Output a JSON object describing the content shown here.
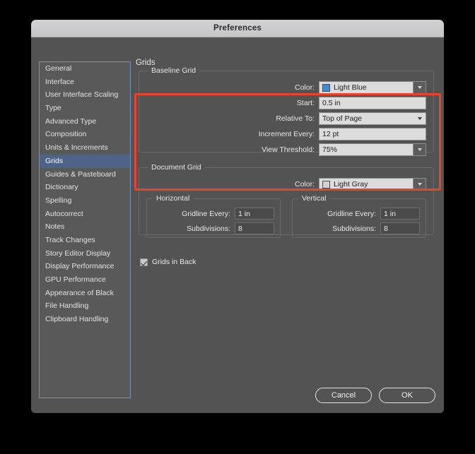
{
  "window": {
    "title": "Preferences"
  },
  "sidebar": {
    "items": [
      {
        "label": "General",
        "selected": false
      },
      {
        "label": "Interface",
        "selected": false
      },
      {
        "label": "User Interface Scaling",
        "selected": false
      },
      {
        "label": "Type",
        "selected": false
      },
      {
        "label": "Advanced Type",
        "selected": false
      },
      {
        "label": "Composition",
        "selected": false
      },
      {
        "label": "Units & Increments",
        "selected": false
      },
      {
        "label": "Grids",
        "selected": true
      },
      {
        "label": "Guides & Pasteboard",
        "selected": false
      },
      {
        "label": "Dictionary",
        "selected": false
      },
      {
        "label": "Spelling",
        "selected": false
      },
      {
        "label": "Autocorrect",
        "selected": false
      },
      {
        "label": "Notes",
        "selected": false
      },
      {
        "label": "Track Changes",
        "selected": false
      },
      {
        "label": "Story Editor Display",
        "selected": false
      },
      {
        "label": "Display Performance",
        "selected": false
      },
      {
        "label": "GPU Performance",
        "selected": false
      },
      {
        "label": "Appearance of Black",
        "selected": false
      },
      {
        "label": "File Handling",
        "selected": false
      },
      {
        "label": "Clipboard Handling",
        "selected": false
      }
    ],
    "selected_color": "#4d6386",
    "border_color": "#6f94c4"
  },
  "pane": {
    "title": "Grids"
  },
  "highlight": {
    "color": "#e8442a",
    "target": "baseline-grid-group"
  },
  "baseline_grid": {
    "legend": "Baseline Grid",
    "color": {
      "label": "Color:",
      "value": "Light Blue",
      "swatch_hex": "#3b8ae0"
    },
    "start": {
      "label": "Start:",
      "value": "0.5 in"
    },
    "relative_to": {
      "label": "Relative To:",
      "value": "Top of Page"
    },
    "increment_every": {
      "label": "Increment Every:",
      "value": "12 pt"
    },
    "view_threshold": {
      "label": "View Threshold:",
      "value": "75%"
    }
  },
  "document_grid": {
    "legend": "Document Grid",
    "color": {
      "label": "Color:",
      "value": "Light Gray",
      "swatch_hex": "#d3d3d3"
    },
    "horizontal": {
      "legend": "Horizontal",
      "gridline_every": {
        "label": "Gridline Every:",
        "value": "1 in"
      },
      "subdivisions": {
        "label": "Subdivisions:",
        "value": "8"
      }
    },
    "vertical": {
      "legend": "Vertical",
      "gridline_every": {
        "label": "Gridline Every:",
        "value": "1 in"
      },
      "subdivisions": {
        "label": "Subdivisions:",
        "value": "8"
      }
    }
  },
  "options": {
    "grids_in_back": {
      "label": "Grids in Back",
      "checked": true
    }
  },
  "footer": {
    "cancel_label": "Cancel",
    "ok_label": "OK"
  }
}
